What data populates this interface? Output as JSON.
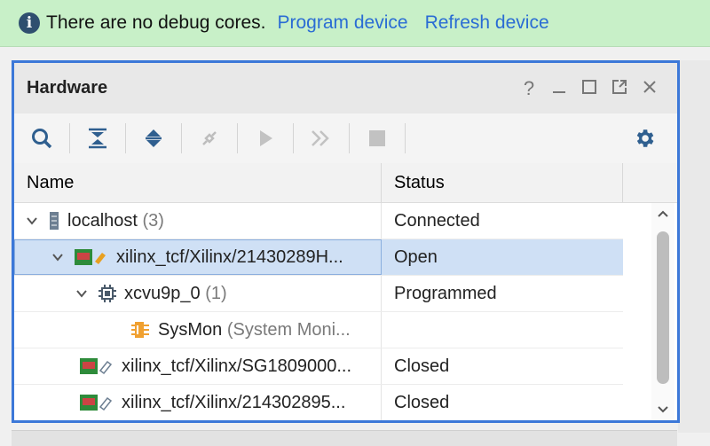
{
  "banner": {
    "message": "There are no debug cores.",
    "program_link": "Program device",
    "refresh_link": "Refresh device"
  },
  "panel": {
    "title": "Hardware",
    "help": "?"
  },
  "columns": [
    "Name",
    "Status"
  ],
  "rows": [
    {
      "name": "localhost",
      "count": "(3)",
      "status": "Connected"
    },
    {
      "name": "xilinx_tcf/Xilinx/21430289H...",
      "count": "",
      "status": "Open"
    },
    {
      "name": "xcvu9p_0",
      "count": "(1)",
      "status": "Programmed"
    },
    {
      "name": "SysMon",
      "count": "(System Moni...",
      "status": ""
    },
    {
      "name": "xilinx_tcf/Xilinx/SG1809000...",
      "count": "",
      "status": "Closed"
    },
    {
      "name": "xilinx_tcf/Xilinx/214302895...",
      "count": "",
      "status": "Closed"
    }
  ],
  "colors": {
    "accent": "#3c78d8",
    "banner": "#c8f0c8",
    "link": "#2a6cd4",
    "selection": "#cfe0f5"
  }
}
